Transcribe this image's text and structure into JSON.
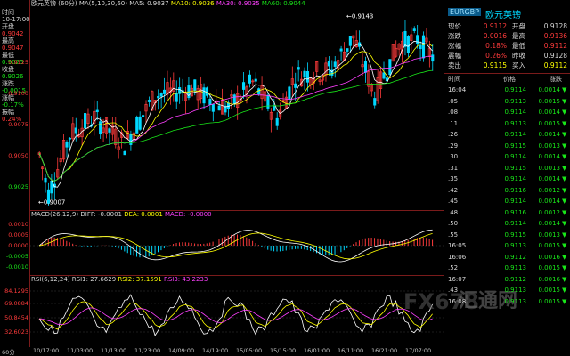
{
  "left_panel": {
    "rows": [
      {
        "label": "时间",
        "value": "10-17:00"
      },
      {
        "label": "开盘",
        "value": "0.9042"
      },
      {
        "label": "最高",
        "value": "0.9047"
      },
      {
        "label": "最低",
        "value": "0.9025"
      },
      {
        "label": "收盘",
        "value": "0.9026"
      },
      {
        "label": "涨跌",
        "value": "-0.0015"
      },
      {
        "label": "涨幅",
        "value": "-0.17%"
      },
      {
        "label": "振幅",
        "value": "0.24%"
      }
    ]
  },
  "main_chart": {
    "title": "欧元英镑 (60分)",
    "ma_label": "MA(5,10,30,60)",
    "ma5": "MA5: 0.9037",
    "ma10": "MA10: 0.9036",
    "ma30": "MA30: 0.9035",
    "ma60": "MA60: 0.9044",
    "y_ticks": [
      "0.9125",
      "0.9100",
      "0.9075",
      "0.9050",
      "0.9025"
    ],
    "high_marker": "0.9143",
    "low_marker": "0.9007",
    "colors": {
      "up": "#ff3b3b",
      "down": "#00d8ff",
      "ma5": "#ffffff",
      "ma10": "#ffff00",
      "ma30": "#ff40ff",
      "ma60": "#19e619"
    }
  },
  "macd_panel": {
    "label": "MACD(26,12,9)",
    "diff": "DIFF: -0.0001",
    "dea": "DEA: 0.0001",
    "macd": "MACD: -0.0000",
    "y_ticks": [
      "0.0010",
      "0.0005",
      "0.0000",
      "-0.0005",
      "-0.0010"
    ]
  },
  "rsi_panel": {
    "label": "RSI(6,12,24)",
    "rsi1": "RSI1: 27.6629",
    "rsi2": "RSI2: 37.1591",
    "rsi3": "RSI3: 43.2233",
    "y_ticks": [
      "84.1295",
      "69.0884",
      "50.8454",
      "32.6023"
    ]
  },
  "x_axis": {
    "period": "60分",
    "ticks": [
      "10/17:00",
      "11/03:00",
      "11/13:00",
      "11/23:00",
      "14/09:00",
      "14/19:00",
      "15/05:00",
      "15/15:00",
      "16/01:00",
      "16/11:00",
      "16/21:00",
      "17/07:00"
    ]
  },
  "quote_panel": {
    "code": "EURGBP",
    "name": "欧元英镑",
    "quotes": [
      {
        "l1": "现价",
        "v1": "0.9112",
        "l2": "开盘",
        "v2": "0.9128"
      },
      {
        "l1": "涨跌",
        "v1": "0.0016",
        "l2": "最高",
        "v2": "0.9136"
      },
      {
        "l1": "涨幅",
        "v1": "0.18%",
        "l2": "最低",
        "v2": "0.9112"
      },
      {
        "l1": "震幅",
        "v1": "0.26%",
        "l2": "昨收",
        "v2": "0.9128"
      },
      {
        "l1": "卖出",
        "v1": "0.9115",
        "l2": "买入",
        "v2": "0.9112"
      }
    ],
    "ticks_header": {
      "time": "时间",
      "price": "价格",
      "change": "涨跌"
    },
    "ticks": [
      {
        "time": "16:04",
        "price": "0.9114",
        "change": "0.0014"
      },
      {
        "time": ".05",
        "price": "0.9113",
        "change": "0.0015"
      },
      {
        "time": ".08",
        "price": "0.9114",
        "change": "0.0014"
      },
      {
        "time": ".11",
        "price": "0.9113",
        "change": "0.0015"
      },
      {
        "time": ".26",
        "price": "0.9114",
        "change": "0.0014"
      },
      {
        "time": ".29",
        "price": "0.9115",
        "change": "0.0013"
      },
      {
        "time": ".30",
        "price": "0.9114",
        "change": "0.0014"
      },
      {
        "time": ".31",
        "price": "0.9115",
        "change": "0.0013"
      },
      {
        "time": ".35",
        "price": "0.9114",
        "change": "0.0014"
      },
      {
        "time": ".42",
        "price": "0.9116",
        "change": "0.0012"
      },
      {
        "time": ".45",
        "price": "0.9114",
        "change": "0.0014"
      },
      {
        "time": ".48",
        "price": "0.9116",
        "change": "0.0012"
      },
      {
        "time": ".50",
        "price": "0.9114",
        "change": "0.0014"
      },
      {
        "time": ".55",
        "price": "0.9115",
        "change": "0.0013"
      },
      {
        "time": "16:05",
        "price": "0.9113",
        "change": "0.0015"
      },
      {
        "time": "16:06",
        "price": "0.9112",
        "change": "0.0016"
      },
      {
        "time": ".52",
        "price": "0.9113",
        "change": "0.0015"
      },
      {
        "time": "16:07",
        "price": "0.9112",
        "change": "0.0016"
      },
      {
        "time": ".43",
        "price": "0.9113",
        "change": "0.0015"
      },
      {
        "time": "16:08",
        "price": "0.9113",
        "change": "0.0015"
      }
    ]
  },
  "watermark": {
    "brand": "FX678",
    "cn": "汇通网"
  }
}
